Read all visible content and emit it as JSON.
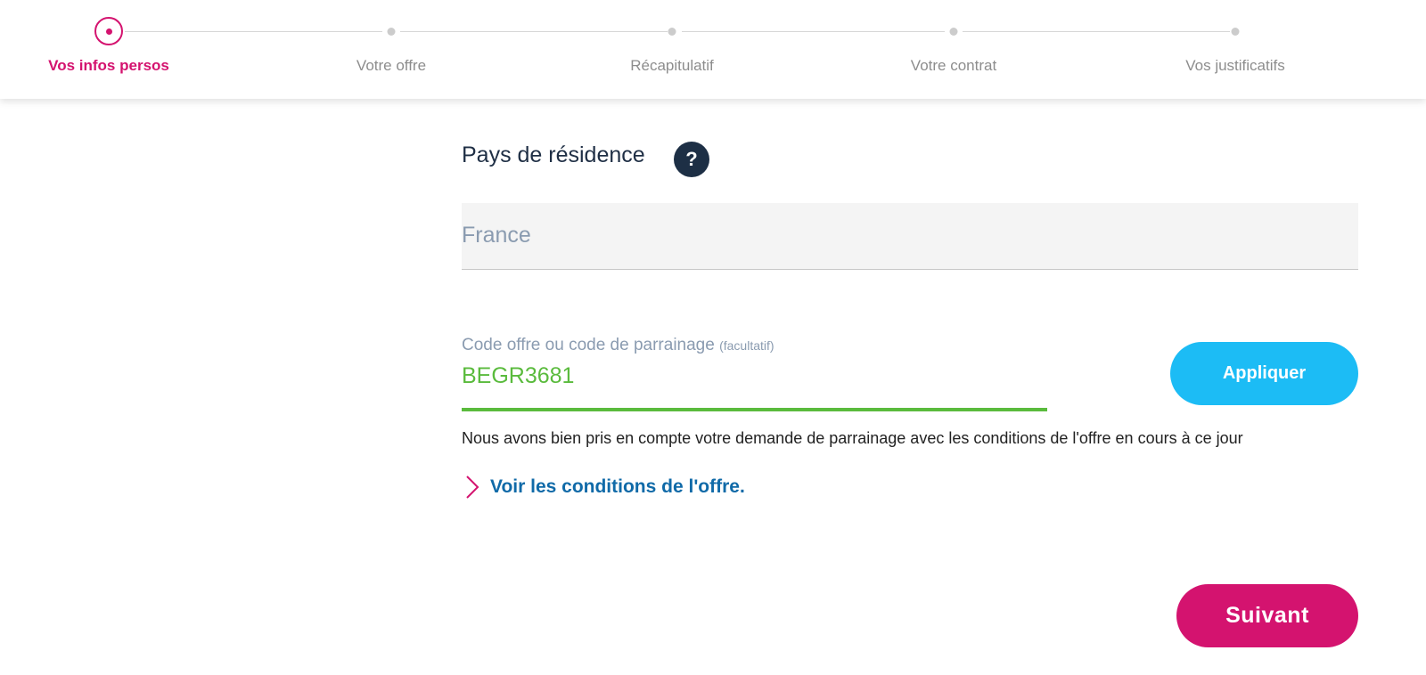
{
  "stepper": {
    "steps": [
      {
        "label": "Vos infos persos",
        "state": "active"
      },
      {
        "label": "Votre offre",
        "state": "pending"
      },
      {
        "label": "Récapitulatif",
        "state": "pending"
      },
      {
        "label": "Votre contrat",
        "state": "pending"
      },
      {
        "label": "Vos justificatifs",
        "state": "pending"
      }
    ]
  },
  "country": {
    "title": "Pays de résidence",
    "help_icon": "question-mark-icon",
    "help_symbol": "?",
    "value": "France"
  },
  "promo": {
    "label": "Code offre ou code de parrainage",
    "optional_note": "(facultatif)",
    "value": "BEGR3681",
    "apply_label": "Appliquer",
    "confirmation": "Nous avons bien pris en compte votre demande de parrainage avec les conditions de l'offre en cours à ce jour",
    "conditions_link": "Voir les conditions de l'offre.",
    "link_icon": "chevron-right-icon"
  },
  "actions": {
    "next_label": "Suivant"
  },
  "colors": {
    "brand_pink": "#d4136f",
    "accent_blue": "#1cbcf5",
    "link_blue": "#106aa8",
    "success_green": "#5abb3d",
    "navy": "#1d2f45"
  }
}
